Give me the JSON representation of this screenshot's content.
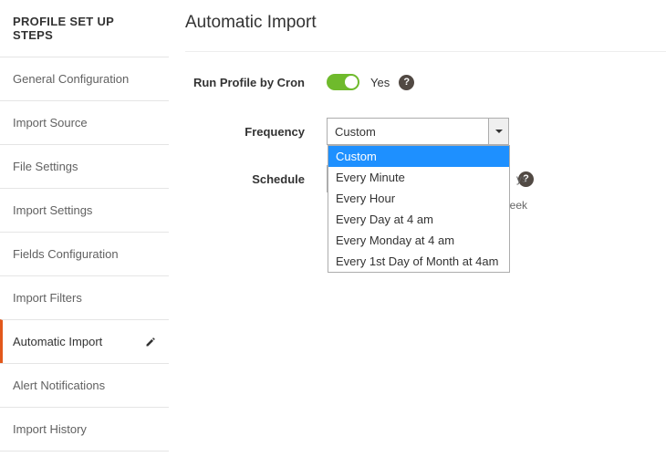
{
  "sidebar": {
    "heading": "PROFILE SET UP STEPS",
    "items": [
      {
        "label": "General Configuration"
      },
      {
        "label": "Import Source"
      },
      {
        "label": "File Settings"
      },
      {
        "label": "Import Settings"
      },
      {
        "label": "Fields Configuration"
      },
      {
        "label": "Import Filters"
      },
      {
        "label": "Automatic Import"
      },
      {
        "label": "Alert Notifications"
      },
      {
        "label": "Import History"
      }
    ],
    "active_index": 6
  },
  "page": {
    "title": "Automatic Import"
  },
  "form": {
    "run_by_cron": {
      "label": "Run Profile by Cron",
      "value_text": "Yes"
    },
    "frequency": {
      "label": "Frequency",
      "selected": "Custom",
      "options": [
        "Custom",
        "Every Minute",
        "Every Hour",
        "Every Day at 4 am",
        "Every Monday at 4 am",
        "Every 1st Day of Month at 4am"
      ]
    },
    "schedule": {
      "label": "Schedule",
      "value": ""
    },
    "hint_partial_1": "ys",
    "hint_partial_2": "eek"
  }
}
